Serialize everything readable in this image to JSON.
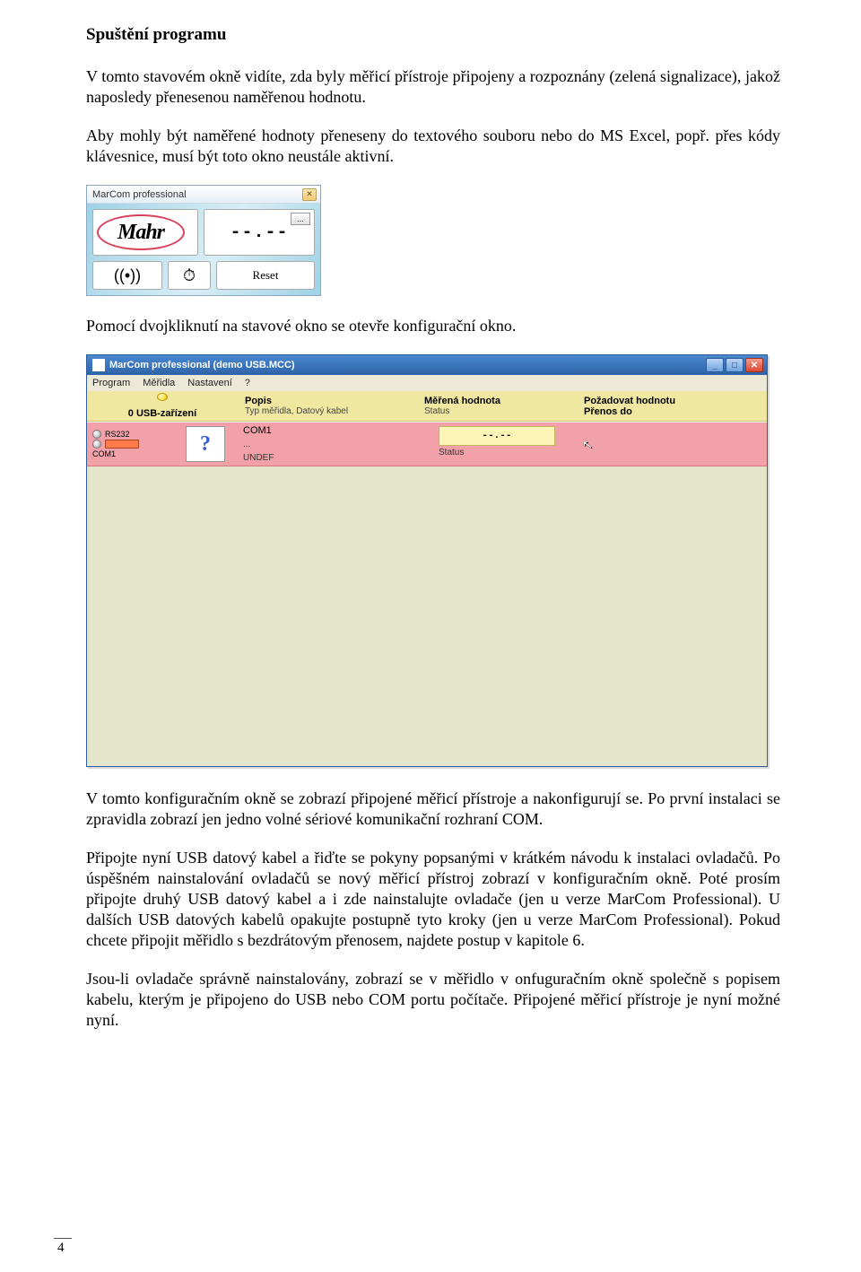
{
  "heading": "Spuštění programu",
  "para1": "V tomto stavovém okně vidíte, zda byly měřicí přístroje připojeny a rozpoznány (zelená signalizace), jakož naposledy přenesenou naměřenou hodnotu.",
  "para2": "Aby mohly být naměřené hodnoty přeneseny do textového souboru nebo do MS Excel, popř. přes kódy klávesnice, musí být toto okno neustále aktivní.",
  "para3": "Pomocí dvojkliknutí na stavové okno se otevře konfigurační okno.",
  "para4": "V tomto konfiguračním okně se zobrazí připojené měřicí přístroje a nakonfigurují se. Po první instalaci se zpravidla zobrazí jen jedno volné sériové komunikační rozhraní COM.",
  "para5": "Připojte nyní USB datový kabel a řiďte se pokyny popsanými v krátkém návodu k instalaci ovladačů. Po úspěšném nainstalování ovladačů se nový měřicí přístroj zobrazí v konfiguračním okně. Poté prosím připojte druhý USB datový kabel a i zde nainstalujte ovladače (jen u verze MarCom Professional). U dalších USB datových kabelů opakujte postupně tyto kroky (jen u verze MarCom Professional). Pokud chcete připojit měřidlo s bezdrátovým přenosem, najdete postup v kapitole 6.",
  "para6": "Jsou-li ovladače správně nainstalovány, zobrazí se v měřidlo v onfuguračním okně společně s popisem kabelu, kterým je připojeno do USB nebo COM portu počítače. Připojené měřicí přístroje je nyní možné nyní.",
  "page_number": "4",
  "widget1": {
    "title": "MarCom professional",
    "brand": "Mahr",
    "readout": "--.--",
    "more": "...",
    "reset": "Reset",
    "antenna": "((•))",
    "clock": "⏱"
  },
  "widget2": {
    "title": "MarCom professional   (demo USB.MCC)",
    "menu": {
      "m1": "Program",
      "m2": "Měřidla",
      "m3": "Nastavení",
      "m4": "?"
    },
    "sub": {
      "usb_devices": "0 USB-zařízení",
      "popis": "Popis",
      "popis_sub": "Typ měřidla, Datový kabel",
      "merena": "Měřená hodnota",
      "status": "Status",
      "pozad": "Požadovat hodnotu",
      "prenos": "Přenos do"
    },
    "row": {
      "rs232": "RS232",
      "com1_lbl": "COM1",
      "com1": "COM1",
      "undef": "UNDEF",
      "dots": "...",
      "val": "--.--",
      "status": "Status",
      "question": "?"
    }
  }
}
